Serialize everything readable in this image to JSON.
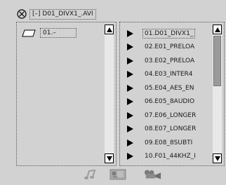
{
  "header": {
    "path": "[–] D01_DIVX1_.AVI"
  },
  "left_panel": {
    "folders": [
      {
        "label": "01.–"
      }
    ]
  },
  "right_panel": {
    "files": [
      {
        "label": "01.D01_DIVX1_",
        "selected": true
      },
      {
        "label": "02.E01_PRELOA"
      },
      {
        "label": "03.E02_PRELOA"
      },
      {
        "label": "04.E03_INTER4"
      },
      {
        "label": "05.E04_AES_EN"
      },
      {
        "label": "06.E05_8AUDIO"
      },
      {
        "label": "07.E06_LONGER"
      },
      {
        "label": "08.E07_LONGER"
      },
      {
        "label": "09.E08_8SUBTI"
      },
      {
        "label": "10.F01_44KHZ_I"
      }
    ]
  },
  "bottom_bar": {
    "icons": [
      "music-icon",
      "photo-icon",
      "video-icon"
    ]
  },
  "colors": {
    "background": "#d2d2d2",
    "scroll_thumb": "#9a9a9a",
    "text": "#1a1a1a"
  }
}
